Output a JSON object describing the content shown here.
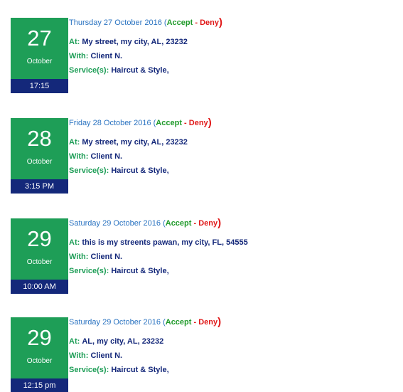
{
  "appointments": [
    {
      "day": "27",
      "month": "October",
      "time": "17:15",
      "date_text": "Thursday 27 October 2016 (",
      "accept": "Accept",
      "separator": "-",
      "deny": "Deny",
      "close_paren": ")",
      "at_label": "At:",
      "at_value": "My street, my city, AL, 23232",
      "with_label": "With:",
      "with_value": "Client N.",
      "services_label": "Service(s):",
      "services_value": "Haircut & Style,"
    },
    {
      "day": "28",
      "month": "October",
      "time": "3:15 PM",
      "date_text": "Friday 28 October 2016 (",
      "accept": "Accept",
      "separator": "-",
      "deny": "Deny",
      "close_paren": ")",
      "at_label": "At:",
      "at_value": "My street, my city, AL, 23232",
      "with_label": "With:",
      "with_value": "Client N.",
      "services_label": "Service(s):",
      "services_value": "Haircut & Style,"
    },
    {
      "day": "29",
      "month": "October",
      "time": "10:00 AM",
      "date_text": "Saturday 29 October 2016 (",
      "accept": "Accept",
      "separator": "-",
      "deny": "Deny",
      "close_paren": ")",
      "at_label": "At:",
      "at_value": "this is my streents pawan, my city, FL, 54555",
      "with_label": "With:",
      "with_value": "Client N.",
      "services_label": "Service(s):",
      "services_value": "Haircut & Style,"
    },
    {
      "day": "29",
      "month": "October",
      "time": "12:15 pm",
      "date_text": "Saturday 29 October 2016 (",
      "accept": "Accept",
      "separator": "-",
      "deny": "Deny",
      "close_paren": ")",
      "at_label": "At:",
      "at_value": "AL, my city, AL, 23232",
      "with_label": "With:",
      "with_value": "Client N.",
      "services_label": "Service(s):",
      "services_value": "Haircut & Style,"
    }
  ]
}
